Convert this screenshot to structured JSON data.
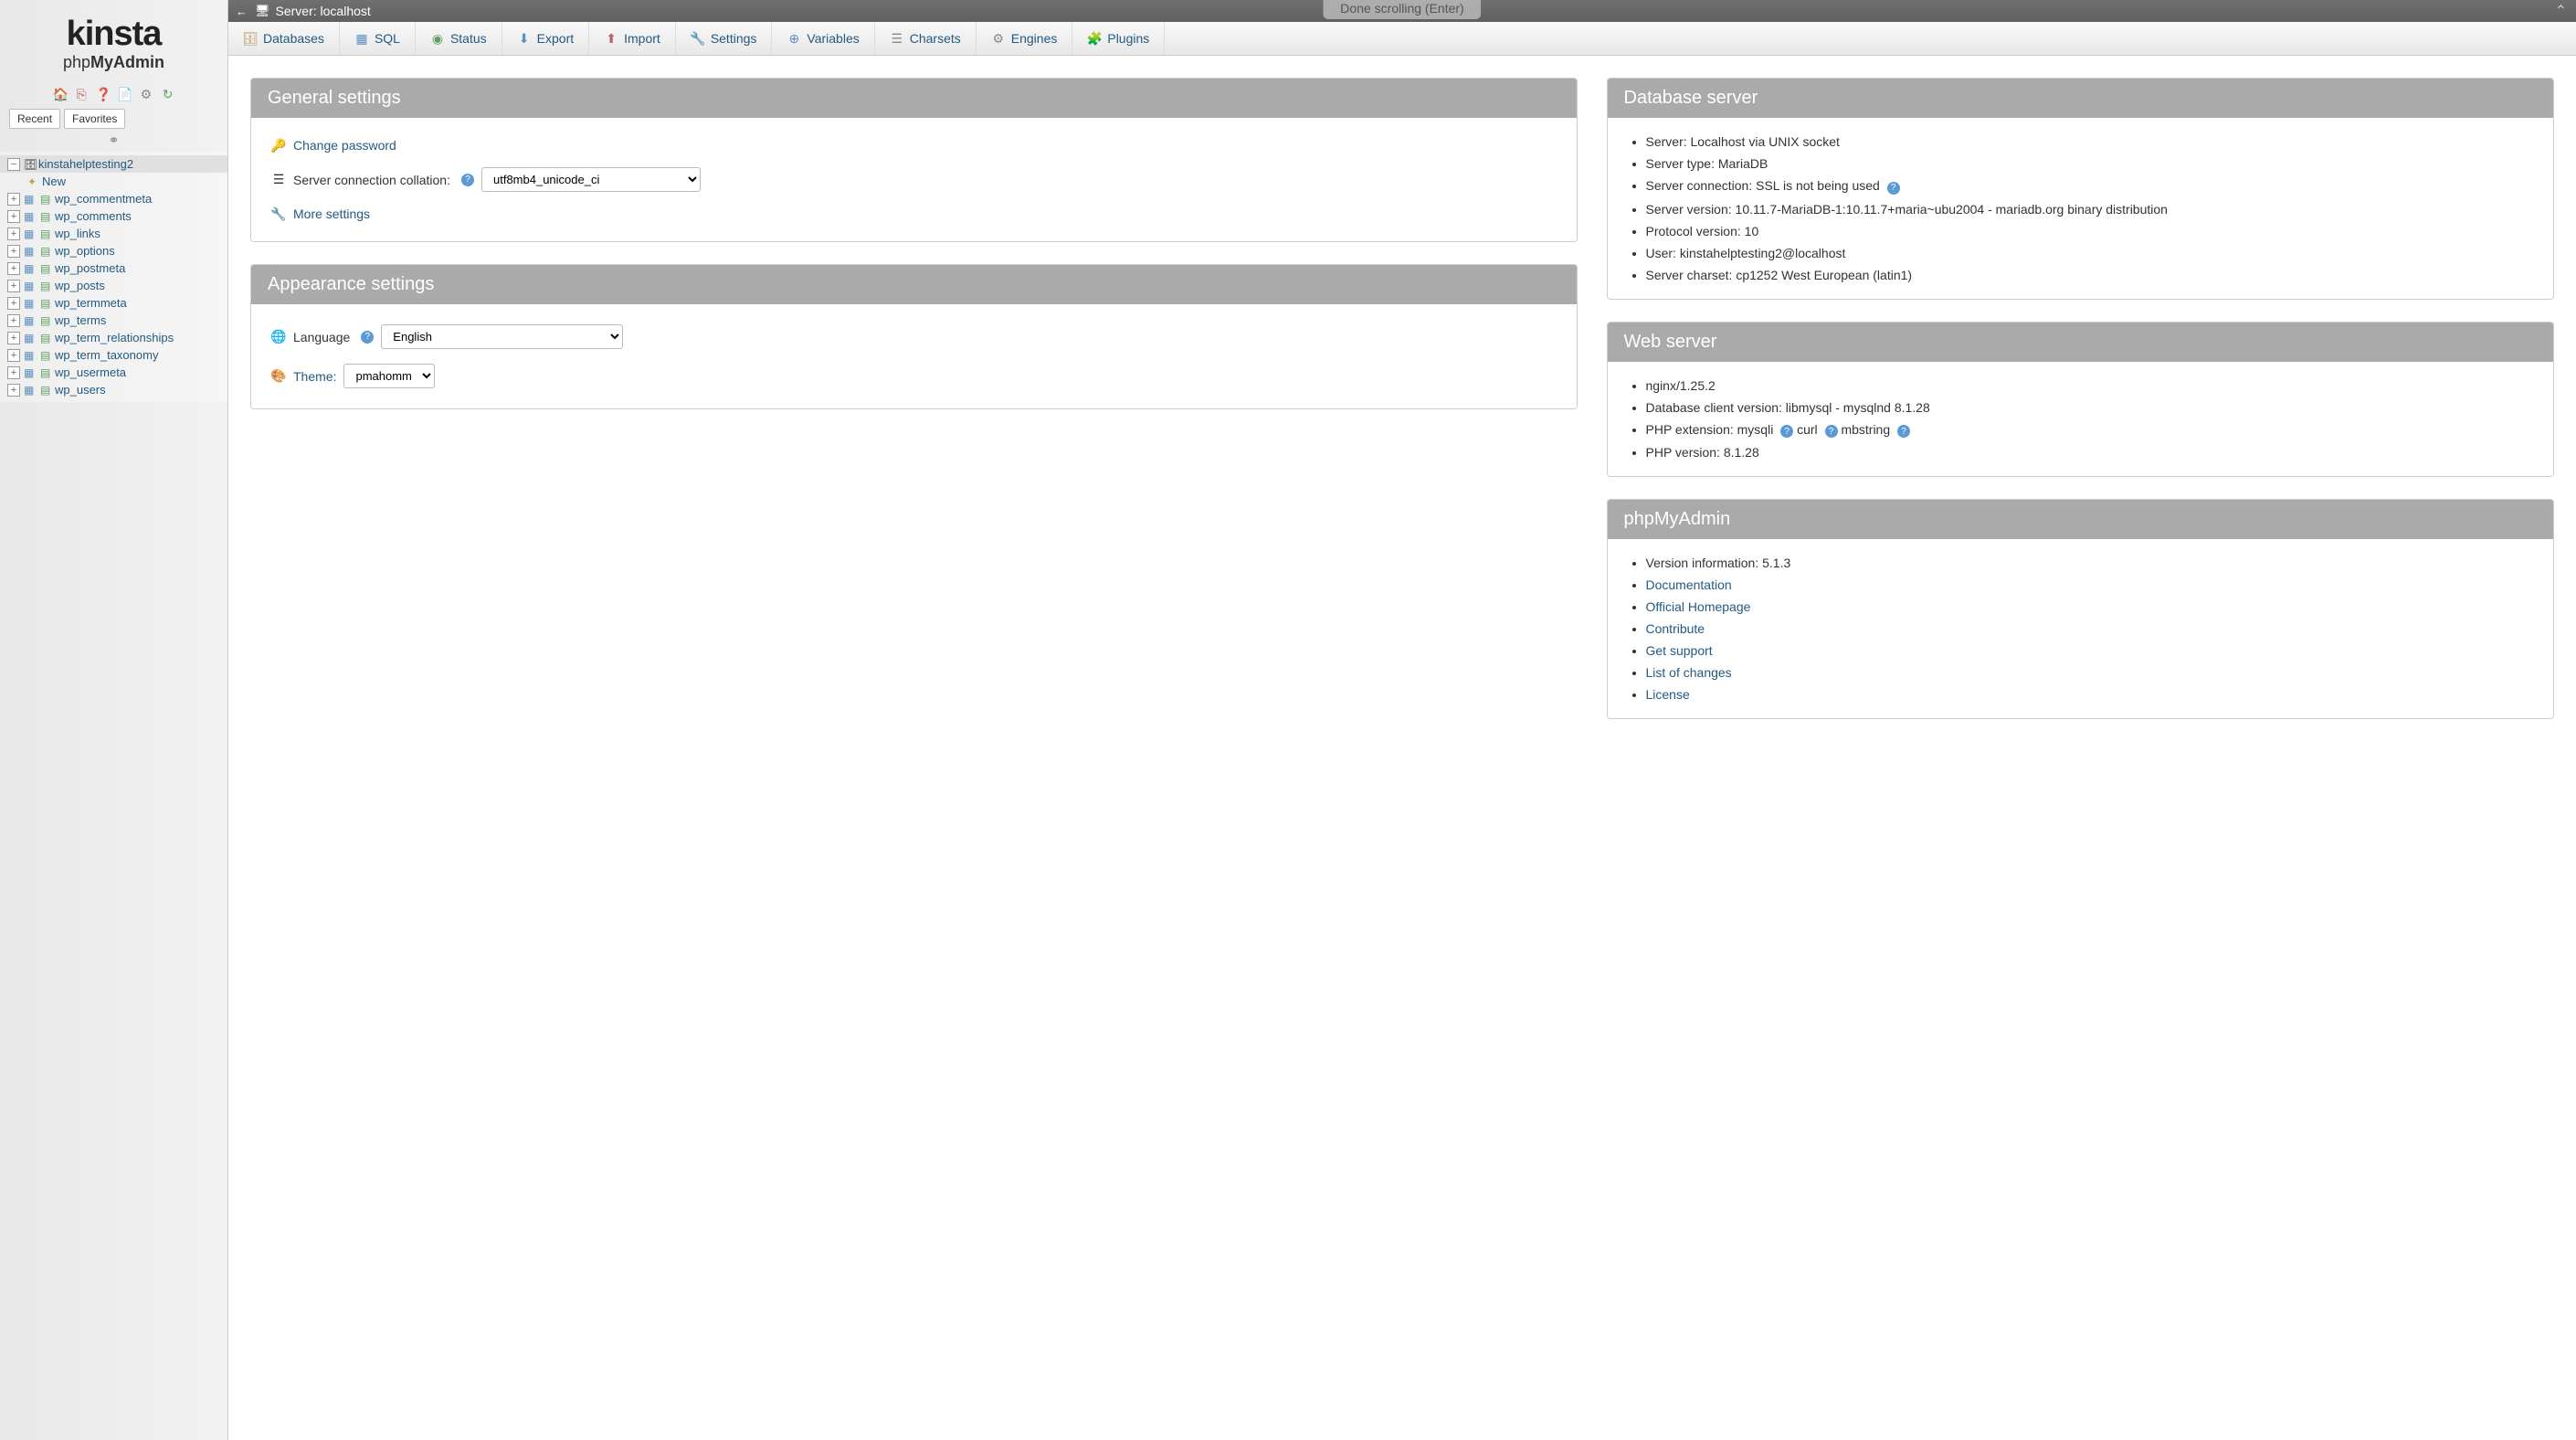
{
  "overlay_hint": "Done scrolling (Enter)",
  "logo": {
    "main": "kinsta",
    "sub_prefix": "php",
    "sub_bold": "MyAdmin"
  },
  "nav_tabs": {
    "recent": "Recent",
    "favorites": "Favorites"
  },
  "breadcrumb": {
    "label": "Server: localhost"
  },
  "tree": {
    "database": "kinstahelptesting2",
    "new_label": "New",
    "tables": [
      "wp_commentmeta",
      "wp_comments",
      "wp_links",
      "wp_options",
      "wp_postmeta",
      "wp_posts",
      "wp_termmeta",
      "wp_terms",
      "wp_term_relationships",
      "wp_term_taxonomy",
      "wp_usermeta",
      "wp_users"
    ]
  },
  "menu": {
    "databases": "Databases",
    "sql": "SQL",
    "status": "Status",
    "export": "Export",
    "import": "Import",
    "settings": "Settings",
    "variables": "Variables",
    "charsets": "Charsets",
    "engines": "Engines",
    "plugins": "Plugins"
  },
  "general": {
    "title": "General settings",
    "change_password": "Change password",
    "collation_label": "Server connection collation:",
    "collation_value": "utf8mb4_unicode_ci",
    "more_settings": "More settings"
  },
  "appearance": {
    "title": "Appearance settings",
    "language_label": "Language",
    "language_value": "English",
    "theme_label": "Theme:",
    "theme_value": "pmahomme"
  },
  "db_server": {
    "title": "Database server",
    "server": "Server: Localhost via UNIX socket",
    "type": "Server type: MariaDB",
    "connection": "Server connection: SSL is not being used",
    "version": "Server version: 10.11.7-MariaDB-1:10.11.7+maria~ubu2004 - mariadb.org binary distribution",
    "protocol": "Protocol version: 10",
    "user": "User: kinstahelptesting2@localhost",
    "charset": "Server charset: cp1252 West European (latin1)"
  },
  "web_server": {
    "title": "Web server",
    "nginx": "nginx/1.25.2",
    "client": "Database client version: libmysql - mysqlnd 8.1.28",
    "ext_label": "PHP extension:",
    "ext_mysqli": "mysqli",
    "ext_curl": "curl",
    "ext_mbstring": "mbstring",
    "php": "PHP version: 8.1.28"
  },
  "pma": {
    "title": "phpMyAdmin",
    "version": "Version information: 5.1.3",
    "docs": "Documentation",
    "homepage": "Official Homepage",
    "contribute": "Contribute",
    "support": "Get support",
    "changes": "List of changes",
    "license": "License"
  }
}
